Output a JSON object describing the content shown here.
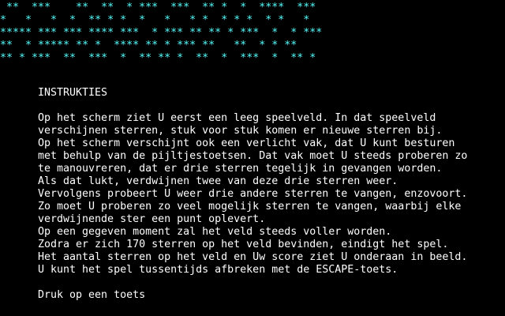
{
  "screen": {
    "background_color": "#000000",
    "text_color": "#ffffff",
    "banner_color": "#55ffff"
  },
  "banner": {
    "lines": [
      " **  ***    **  **  * ***  ***  ** *  *  ****  ***",
      "*   *   *  *  ** * *  *   *   * *  * * *  * *   *",
      "***** *** *** **** ***  * *** ** ** * ***  *  * ***",
      "**  * ***** ** *  **** ** * *** **   **  * * **",
      "** * ***  **  ***  *  ** ** *  **  *  ***  *  ** *"
    ]
  },
  "instructions": {
    "title": "INSTRUKTIES",
    "paragraph": [
      "Op het scherm ziet U eerst een leeg speelveld. In dat speelveld",
      "verschijnen sterren, stuk voor stuk komen er nieuwe sterren bij.",
      "Op het scherm verschijnt ook een verlicht vak, dat U kunt besturen",
      "met behulp van de pijltjestoetsen. Dat vak moet U steeds proberen zo",
      "te manouvreren, dat er drie sterren tegelijk in gevangen worden.",
      "Als dat lukt, verdwijnen twee van deze drie sterren weer.",
      "Vervolgens probeert U weer drie andere sterren te vangen, enzovoort.",
      "Zo moet U proberen zo veel mogelijk sterren te vangen, waarbij elke",
      "verdwijnende ster een punt oplevert.",
      "Op een gegeven moment zal het veld steeds voller worden.",
      "Zodra er zich 170 sterren op het veld bevinden, eindigt het spel.",
      "Het aantal sterren op het veld en Uw score ziet U onderaan in beeld.",
      "U kunt het spel tussentijds afbreken met de ESCAPE-toets."
    ],
    "prompt": "Druk op een toets"
  }
}
